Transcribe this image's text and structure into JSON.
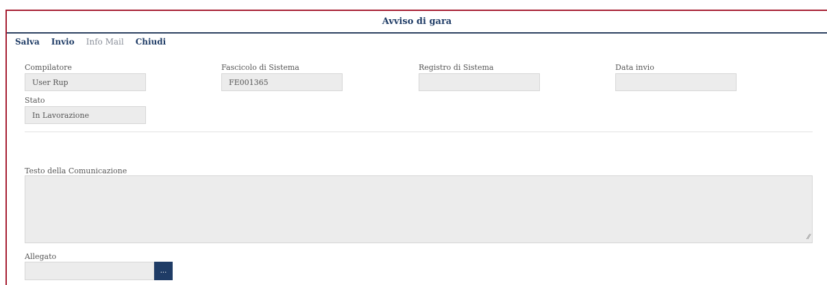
{
  "window": {
    "title": "Avviso di gara"
  },
  "toolbar": {
    "salva": "Salva",
    "invio": "Invio",
    "info_mail": "Info Mail",
    "chiudi": "Chiudi"
  },
  "fields": {
    "compilatore": {
      "label": "Compilatore",
      "value": "User Rup"
    },
    "fascicolo": {
      "label": "Fascicolo di Sistema",
      "value": "FE001365"
    },
    "registro": {
      "label": "Registro di Sistema",
      "value": ""
    },
    "data_invio": {
      "label": "Data invio",
      "value": ""
    },
    "stato": {
      "label": "Stato",
      "value": "In Lavorazione"
    }
  },
  "testo": {
    "label": "Testo della Comunicazione",
    "value": ""
  },
  "allegato": {
    "label": "Allegato",
    "value": "",
    "button": "..."
  },
  "colors": {
    "accent": "#a51c30",
    "primary": "#1f3c66",
    "field_bg": "#ececec"
  }
}
